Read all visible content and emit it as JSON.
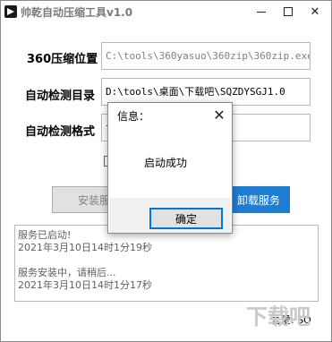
{
  "window": {
    "title": "帅乾自动压缩工具v1.0",
    "minimize_icon": "minimize-icon",
    "maximize_icon": "maximize-icon",
    "close_glyph": "✕"
  },
  "form": {
    "path_label": "360压缩位置",
    "path_value": "C:\\tools\\360yasuo\\360zip\\360zip.exe",
    "dir_label": "自动检测目录",
    "dir_value": "D:\\tools\\桌面\\下载吧\\SQZDYSGJ1.0",
    "format_label": "自动检测格式",
    "format_value": "ta"
  },
  "buttons": {
    "install": "安装服务",
    "uninstall": "卸载服务"
  },
  "log": {
    "lines": [
      "服务已启动!",
      "2021年3月10日14时1分19秒",
      "",
      "服务安装中，请稍后...",
      "2021年3月10日14时1分17秒"
    ]
  },
  "status": {
    "author": "吾爱: SQ"
  },
  "dialog": {
    "title": "信息：",
    "message": "启动成功",
    "ok_label": "确定",
    "close_glyph": "✕"
  },
  "watermark": {
    "text": "下载吧",
    "color": "#c8c8c8"
  },
  "colors": {
    "accent": "#1f7dd1",
    "ok_border": "#0078d7"
  }
}
